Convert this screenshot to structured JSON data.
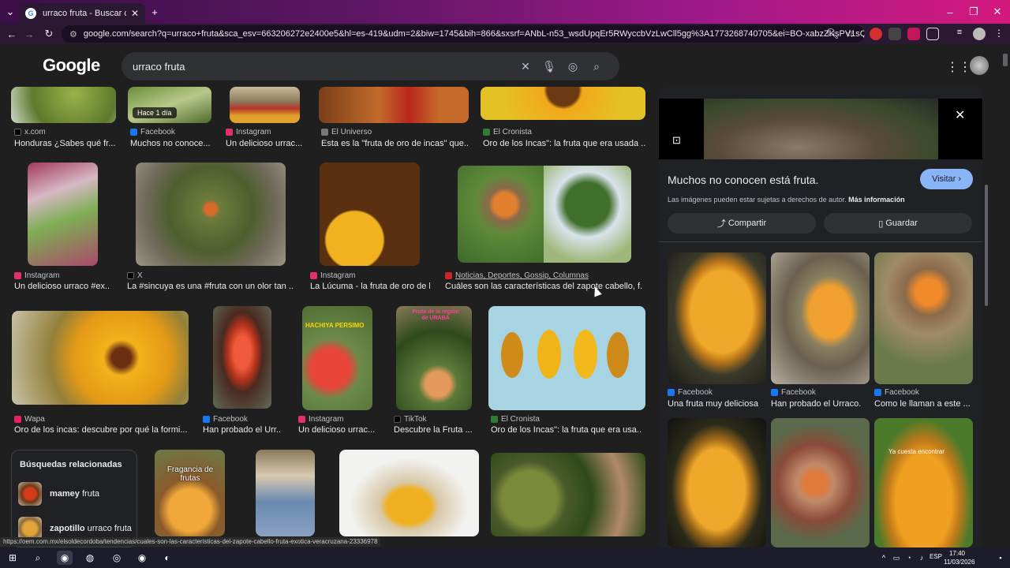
{
  "browser": {
    "tab_title": "urraco fruta - Buscar con Google",
    "url": "google.com/search?q=urraco+fruta&sca_esv=663206272e2400e5&hl=es-419&udm=2&biw=1745&bih=866&sxsrf=ANbL-n53_wsdUpqEr5RWyccbVzLwCll5gg%3A1773268740705&ei=BO-xabzZKsPV1sQPvouV4Aw&ved=0ahU..."
  },
  "google": {
    "logo": "Google",
    "query": "urraco fruta"
  },
  "results": [
    {
      "source": "x.com",
      "title": "Honduras ¿Sabes qué fr...",
      "icon_color": "#000000"
    },
    {
      "source": "Facebook",
      "title": "Muchos no conoce...",
      "icon_color": "#1877f2",
      "badge": "Hace 1 día"
    },
    {
      "source": "Instagram",
      "title": "Un delicioso urrac...",
      "icon_color": "#e1306c"
    },
    {
      "source": "El Universo",
      "title": "Esta es la \"fruta de oro de incas\" que...",
      "icon_color": "#666666"
    },
    {
      "source": "El Cronista",
      "title": "Oro de los Incas\": la fruta que era usada ...",
      "icon_color": "#2e7d32"
    },
    {
      "source": "Instagram",
      "title": "Un delicioso urraco #ex...",
      "icon_color": "#e1306c"
    },
    {
      "source": "X",
      "title": "La #sincuya es una #fruta con un olor tan ...",
      "icon_color": "#000000"
    },
    {
      "source": "Instagram",
      "title": "La Lúcuma - la fruta de oro de lo...",
      "icon_color": "#e1306c"
    },
    {
      "source": "Noticias, Deportes, Gossip, Columnas",
      "title": "Cuáles son las características del zapote cabello, f...",
      "icon_color": "#c62828"
    },
    {
      "source": "Wapa",
      "title": "Oro de los incas: descubre por qué la formi...",
      "icon_color": "#e91e63"
    },
    {
      "source": "Facebook",
      "title": "Han probado el Urr...",
      "icon_color": "#1877f2"
    },
    {
      "source": "Instagram",
      "title": "Un delicioso urrac...",
      "icon_color": "#e1306c"
    },
    {
      "source": "TikTok",
      "title": "Descubre la Fruta ...",
      "icon_color": "#000000"
    },
    {
      "source": "El Cronista",
      "title": "Oro de los Incas\": la fruta que era usa...",
      "icon_color": "#2e7d32"
    }
  ],
  "thumb_texts": {
    "hachiya": "HACHIYA PERSIMO",
    "uraba": "Fruta de la región de URABÁ",
    "fragancia": "Fragancia de frutas",
    "ya_cuesta": "Ya cuesta encontrar"
  },
  "related": {
    "heading": "Búsquedas relacionadas",
    "items": [
      {
        "bold": "mamey",
        "rest": " fruta"
      },
      {
        "bold": "zapotillo",
        "rest": " urraco fruta"
      }
    ]
  },
  "panel": {
    "title": "Muchos no conocen está fruta.",
    "visit_label": "Visitar",
    "rights_text": "Las imágenes pueden estar sujetas a derechos de autor.",
    "more_info": "Más información",
    "share_label": "Compartir",
    "save_label": "Guardar",
    "related_results": [
      {
        "source": "Facebook",
        "title": "Una fruta muy deliciosa"
      },
      {
        "source": "Facebook",
        "title": "Han probado el Urraco."
      },
      {
        "source": "Facebook",
        "title": "Como le llaman a este ..."
      }
    ]
  },
  "status_url": "https://oem.com.mx/elsoldecordoba/tendencias/cuales-son-las-caracteristicas-del-zapote-cabello-fruta-exotica-veracruzana-23336978",
  "taskbar": {
    "language": "ESP",
    "time": "17:40",
    "date": "11/03/2026"
  },
  "colors": {
    "accent": "#8ab4f8",
    "bg": "#1f1f1f"
  }
}
